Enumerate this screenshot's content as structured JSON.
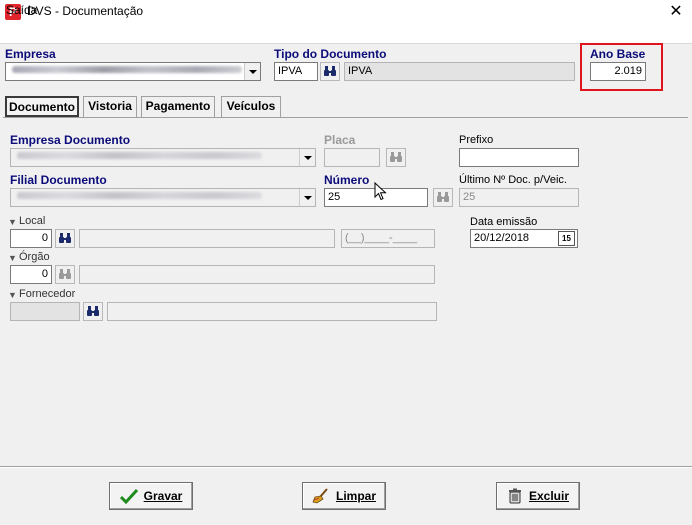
{
  "window": {
    "title": "DVS - Documentação",
    "close_glyph": "✕",
    "icon_letter": "P"
  },
  "menu": {
    "items": [
      "Saída"
    ]
  },
  "header": {
    "empresa_label": "Empresa",
    "tipo_label": "Tipo do Documento",
    "tipo_code": "IPVA",
    "tipo_desc": "IPVA",
    "ano_label": "Ano Base",
    "ano_value": "2.019"
  },
  "tabs": [
    "Documento",
    "Vistoria",
    "Pagamento",
    "Veículos"
  ],
  "form": {
    "empresa_doc_label": "Empresa Documento",
    "placa_label": "Placa",
    "prefixo_label": "Prefixo",
    "filial_label": "Filial Documento",
    "numero_label": "Número",
    "numero_value": "25",
    "ultimo_label": "Último Nº Doc. p/Veic.",
    "ultimo_value": "25",
    "local_label": "Local",
    "local_value": "0",
    "masked_value": "(__)____-____",
    "data_label": "Data emissão",
    "data_value": "20/12/2018",
    "orgao_label": "Órgão",
    "orgao_value": "0",
    "fornecedor_label": "Fornecedor",
    "calendar_glyph": "15"
  },
  "buttons": {
    "gravar_label": "Gravar",
    "limpar_label": "Limpar",
    "excluir_label": "Excluir"
  },
  "colors": {
    "label_blue": "#0b0b7a",
    "highlight_red": "#e0141c",
    "app_icon_red": "#e0252c"
  }
}
